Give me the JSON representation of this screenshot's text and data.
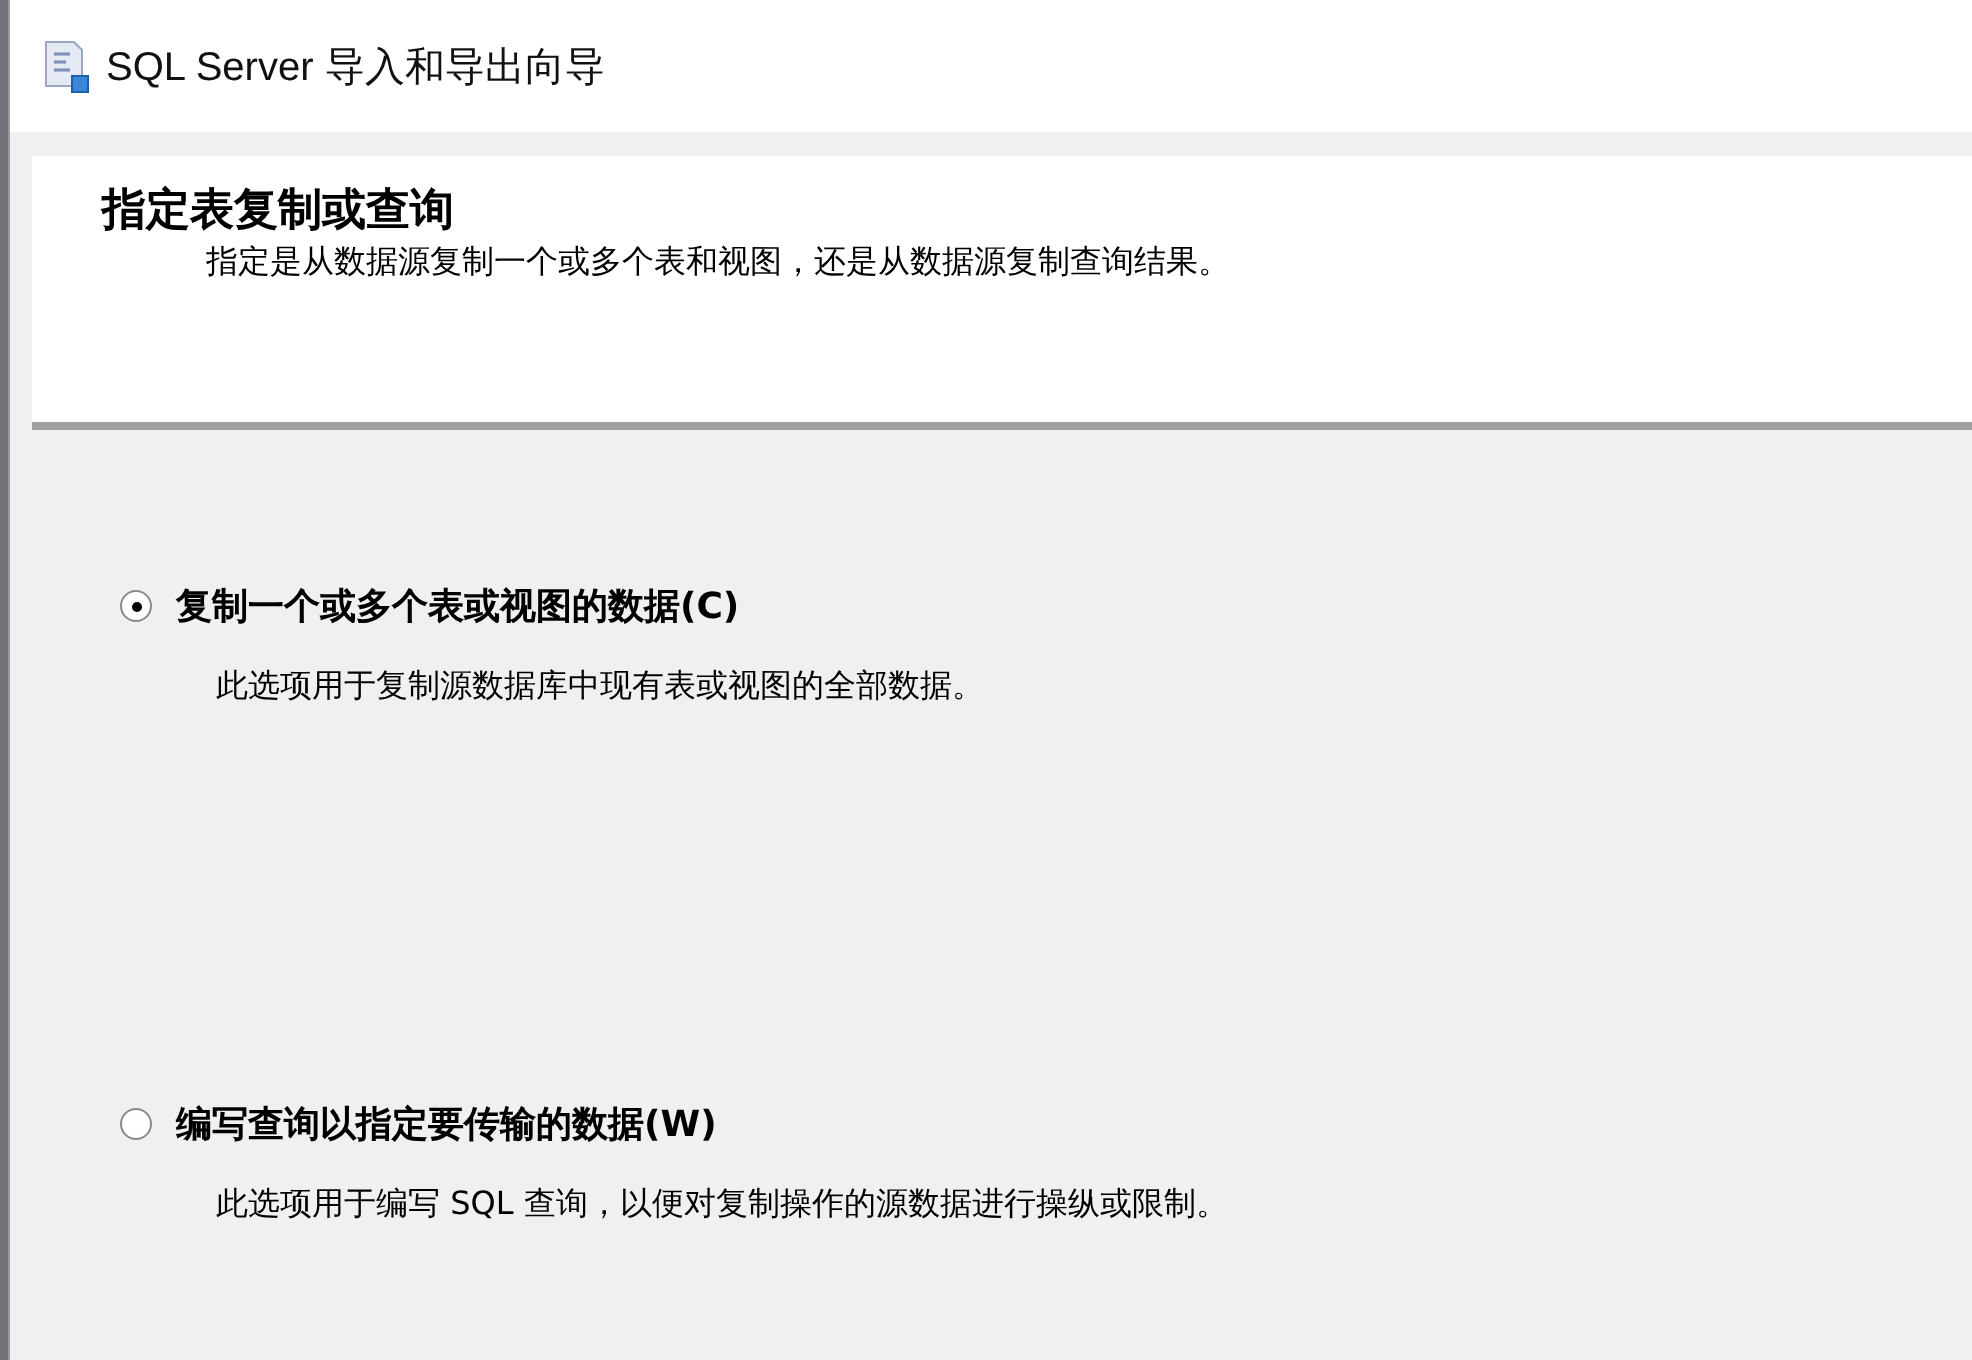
{
  "window": {
    "title": "SQL Server 导入和导出向导"
  },
  "header": {
    "title": "指定表复制或查询",
    "description": "指定是从数据源复制一个或多个表和视图，还是从数据源复制查询结果。"
  },
  "options": [
    {
      "label": "复制一个或多个表或视图的数据",
      "mnemonic": "(C)",
      "description": "此选项用于复制源数据库中现有表或视图的全部数据。",
      "selected": true
    },
    {
      "label": "编写查询以指定要传输的数据",
      "mnemonic": "(W)",
      "description": "此选项用于编写 SQL 查询，以便对复制操作的源数据进行操纵或限制。",
      "selected": false
    }
  ]
}
